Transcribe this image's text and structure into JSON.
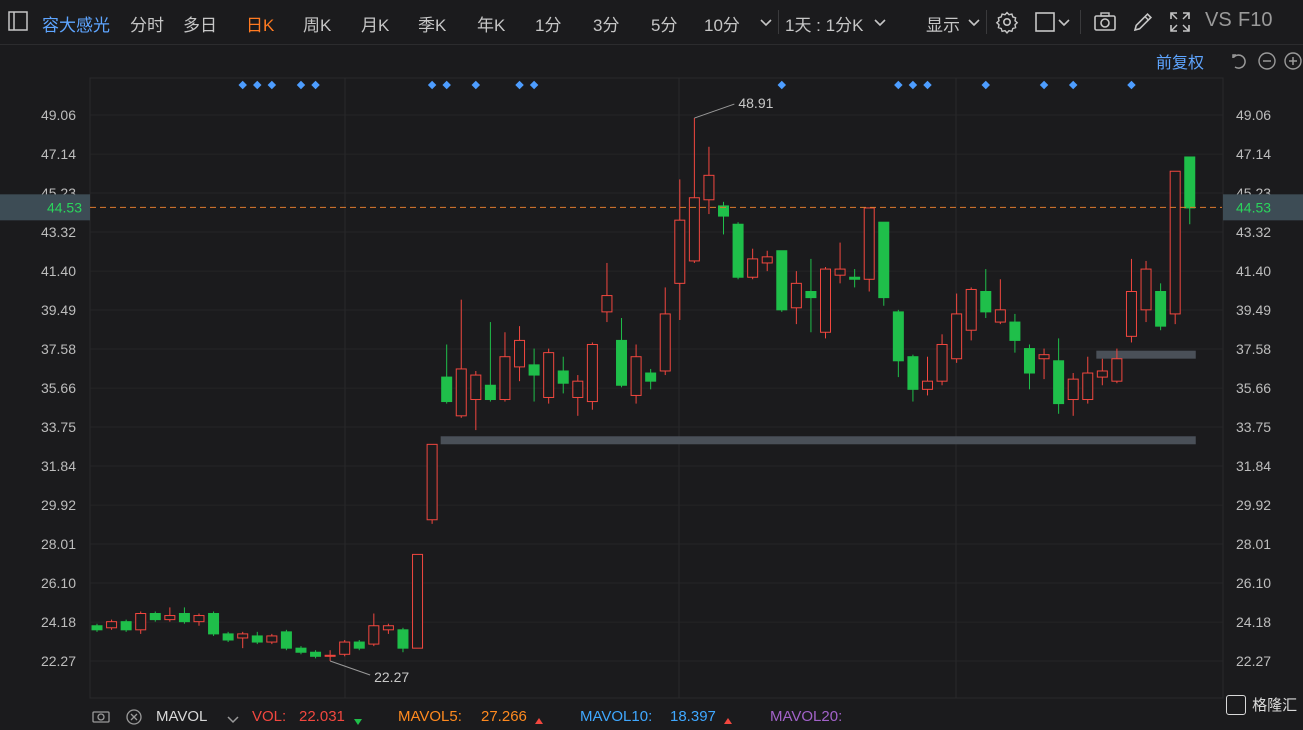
{
  "toolbar": {
    "stock_name": "容大感光",
    "tabs": [
      "分时",
      "多日",
      "日K",
      "周K",
      "月K",
      "季K",
      "年K",
      "1分",
      "3分",
      "5分",
      "10分"
    ],
    "active_tab": "日K",
    "interval_select": "1天 : 1分K",
    "display_label": "显示",
    "vs_label": "VS",
    "f10_label": "F10"
  },
  "adjust_label": "前复权",
  "price_axis": {
    "ticks": [
      "49.06",
      "47.14",
      "45.23",
      "43.32",
      "41.40",
      "39.49",
      "37.58",
      "35.66",
      "33.75",
      "31.84",
      "29.92",
      "28.01",
      "26.10",
      "24.18",
      "22.27"
    ],
    "current_price": "44.53",
    "min_price": 22.27,
    "max_price": 49.06
  },
  "annotations": {
    "high_label": "48.91",
    "low_label": "22.27"
  },
  "volume_bar": {
    "indicator": "MAVOL",
    "vol_label": "VOL:",
    "vol_value": "22.031",
    "mavol5_label": "MAVOL5:",
    "mavol5_value": "27.266",
    "mavol10_label": "MAVOL10:",
    "mavol10_value": "18.397",
    "mavol20_label": "MAVOL20:"
  },
  "colors": {
    "up": "#f2473f",
    "down": "#1fbf4a",
    "current_line": "#e07b2e",
    "marker": "#4d9dff",
    "support": "#4a5058"
  },
  "watermark": "格隆汇",
  "chart_data": {
    "type": "candlestick",
    "series": [
      {
        "o": 24.0,
        "c": 23.8,
        "h": 24.1,
        "l": 23.7
      },
      {
        "o": 23.9,
        "c": 24.2,
        "h": 24.3,
        "l": 23.8
      },
      {
        "o": 24.2,
        "c": 23.8,
        "h": 24.3,
        "l": 23.7
      },
      {
        "o": 23.8,
        "c": 24.6,
        "h": 24.7,
        "l": 23.6
      },
      {
        "o": 24.6,
        "c": 24.3,
        "h": 24.7,
        "l": 24.2
      },
      {
        "o": 24.3,
        "c": 24.5,
        "h": 24.9,
        "l": 24.2
      },
      {
        "o": 24.6,
        "c": 24.2,
        "h": 24.9,
        "l": 24.1
      },
      {
        "o": 24.2,
        "c": 24.5,
        "h": 24.6,
        "l": 24.0
      },
      {
        "o": 24.6,
        "c": 23.6,
        "h": 24.7,
        "l": 23.5
      },
      {
        "o": 23.6,
        "c": 23.3,
        "h": 23.7,
        "l": 23.2
      },
      {
        "o": 23.4,
        "c": 23.6,
        "h": 23.7,
        "l": 22.9
      },
      {
        "o": 23.5,
        "c": 23.2,
        "h": 23.7,
        "l": 23.1
      },
      {
        "o": 23.2,
        "c": 23.5,
        "h": 23.6,
        "l": 23.1
      },
      {
        "o": 23.7,
        "c": 22.9,
        "h": 23.8,
        "l": 22.8
      },
      {
        "o": 22.9,
        "c": 22.7,
        "h": 23.0,
        "l": 22.6
      },
      {
        "o": 22.7,
        "c": 22.5,
        "h": 22.8,
        "l": 22.4
      },
      {
        "o": 22.5,
        "c": 22.55,
        "h": 22.8,
        "l": 22.27
      },
      {
        "o": 22.6,
        "c": 23.2,
        "h": 23.3,
        "l": 22.5
      },
      {
        "o": 23.2,
        "c": 22.9,
        "h": 23.3,
        "l": 22.8
      },
      {
        "o": 23.1,
        "c": 24.0,
        "h": 24.6,
        "l": 23.0
      },
      {
        "o": 23.8,
        "c": 24.0,
        "h": 24.1,
        "l": 23.6
      },
      {
        "o": 23.8,
        "c": 22.9,
        "h": 23.9,
        "l": 22.7
      },
      {
        "o": 22.9,
        "c": 27.5,
        "h": 27.5,
        "l": 22.9
      },
      {
        "o": 29.2,
        "c": 32.9,
        "h": 32.9,
        "l": 29.0
      },
      {
        "o": 36.2,
        "c": 35.0,
        "h": 37.8,
        "l": 34.9
      },
      {
        "o": 34.3,
        "c": 36.6,
        "h": 40.0,
        "l": 34.2
      },
      {
        "o": 35.1,
        "c": 36.3,
        "h": 36.5,
        "l": 33.6
      },
      {
        "o": 35.8,
        "c": 35.1,
        "h": 38.9,
        "l": 35.0
      },
      {
        "o": 35.1,
        "c": 37.2,
        "h": 38.4,
        "l": 35.0
      },
      {
        "o": 36.7,
        "c": 38.0,
        "h": 38.7,
        "l": 36.0
      },
      {
        "o": 36.8,
        "c": 36.3,
        "h": 37.6,
        "l": 35.0
      },
      {
        "o": 35.2,
        "c": 37.4,
        "h": 37.6,
        "l": 34.9
      },
      {
        "o": 36.5,
        "c": 35.9,
        "h": 37.2,
        "l": 35.4
      },
      {
        "o": 35.2,
        "c": 36.0,
        "h": 36.3,
        "l": 34.3
      },
      {
        "o": 35.0,
        "c": 37.8,
        "h": 37.9,
        "l": 34.6
      },
      {
        "o": 39.4,
        "c": 40.2,
        "h": 41.8,
        "l": 38.9
      },
      {
        "o": 38.0,
        "c": 35.8,
        "h": 39.1,
        "l": 35.7
      },
      {
        "o": 35.3,
        "c": 37.2,
        "h": 37.8,
        "l": 34.9
      },
      {
        "o": 36.4,
        "c": 36.0,
        "h": 36.6,
        "l": 35.6
      },
      {
        "o": 36.5,
        "c": 39.3,
        "h": 40.6,
        "l": 36.3
      },
      {
        "o": 40.8,
        "c": 43.9,
        "h": 45.9,
        "l": 39.0
      },
      {
        "o": 41.9,
        "c": 45.0,
        "h": 48.91,
        "l": 41.8
      },
      {
        "o": 44.9,
        "c": 46.1,
        "h": 47.5,
        "l": 44.2
      },
      {
        "o": 44.6,
        "c": 44.1,
        "h": 44.8,
        "l": 43.2
      },
      {
        "o": 43.7,
        "c": 41.1,
        "h": 43.8,
        "l": 41.0
      },
      {
        "o": 41.1,
        "c": 42.0,
        "h": 42.5,
        "l": 41.0
      },
      {
        "o": 41.8,
        "c": 42.1,
        "h": 42.4,
        "l": 41.4
      },
      {
        "o": 42.4,
        "c": 39.5,
        "h": 42.4,
        "l": 39.4
      },
      {
        "o": 39.6,
        "c": 40.8,
        "h": 41.4,
        "l": 38.8
      },
      {
        "o": 40.4,
        "c": 40.1,
        "h": 42.0,
        "l": 38.4
      },
      {
        "o": 38.4,
        "c": 41.5,
        "h": 41.6,
        "l": 38.1
      },
      {
        "o": 41.2,
        "c": 41.5,
        "h": 42.8,
        "l": 40.8
      },
      {
        "o": 41.1,
        "c": 41.0,
        "h": 41.5,
        "l": 40.6
      },
      {
        "o": 41.0,
        "c": 44.5,
        "h": 44.5,
        "l": 40.4
      },
      {
        "o": 43.8,
        "c": 40.1,
        "h": 43.8,
        "l": 39.7
      },
      {
        "o": 39.4,
        "c": 37.0,
        "h": 39.5,
        "l": 36.2
      },
      {
        "o": 37.2,
        "c": 35.6,
        "h": 37.3,
        "l": 35.0
      },
      {
        "o": 35.6,
        "c": 36.0,
        "h": 37.2,
        "l": 35.3
      },
      {
        "o": 36.0,
        "c": 37.8,
        "h": 38.3,
        "l": 35.8
      },
      {
        "o": 37.1,
        "c": 39.3,
        "h": 40.3,
        "l": 36.9
      },
      {
        "o": 38.5,
        "c": 40.5,
        "h": 40.6,
        "l": 38.0
      },
      {
        "o": 40.4,
        "c": 39.4,
        "h": 41.5,
        "l": 39.1
      },
      {
        "o": 38.9,
        "c": 39.5,
        "h": 41.0,
        "l": 38.8
      },
      {
        "o": 38.9,
        "c": 38.0,
        "h": 39.3,
        "l": 37.4
      },
      {
        "o": 37.6,
        "c": 36.4,
        "h": 37.8,
        "l": 35.6
      },
      {
        "o": 37.1,
        "c": 37.3,
        "h": 37.6,
        "l": 36.1
      },
      {
        "o": 37.0,
        "c": 34.9,
        "h": 38.1,
        "l": 34.4
      },
      {
        "o": 35.1,
        "c": 36.1,
        "h": 36.4,
        "l": 34.3
      },
      {
        "o": 35.1,
        "c": 36.4,
        "h": 37.2,
        "l": 34.9
      },
      {
        "o": 36.2,
        "c": 36.5,
        "h": 37.1,
        "l": 35.8
      },
      {
        "o": 36.0,
        "c": 37.1,
        "h": 37.6,
        "l": 35.9
      },
      {
        "o": 38.2,
        "c": 40.4,
        "h": 42.0,
        "l": 37.9
      },
      {
        "o": 39.5,
        "c": 41.5,
        "h": 41.9,
        "l": 38.9
      },
      {
        "o": 40.4,
        "c": 38.7,
        "h": 40.8,
        "l": 38.5
      },
      {
        "o": 39.3,
        "c": 46.3,
        "h": 46.3,
        "l": 38.8
      },
      {
        "o": 47.0,
        "c": 44.5,
        "h": 47.0,
        "l": 43.7
      }
    ],
    "support_levels": [
      {
        "price": 33.1,
        "from": 24,
        "to": 75
      },
      {
        "price": 37.3,
        "from": 69,
        "to": 75
      }
    ],
    "markers": [
      10,
      11,
      12,
      14,
      15,
      23,
      24,
      26,
      29,
      30,
      47,
      55,
      56,
      57,
      61,
      65,
      67,
      71
    ]
  }
}
